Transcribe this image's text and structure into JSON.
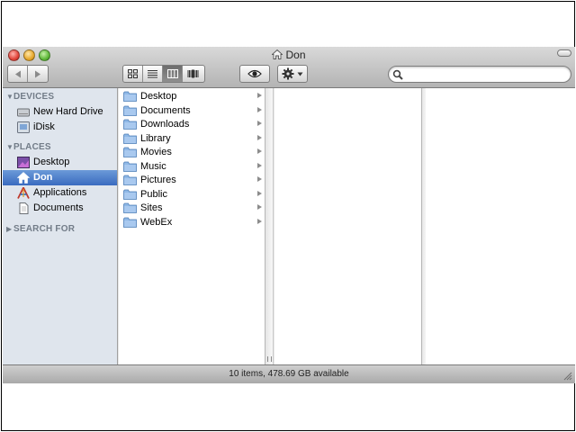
{
  "window": {
    "title": "Don"
  },
  "toolbar": {
    "back_label": "◀",
    "forward_label": "▶",
    "view_modes": [
      "icon-view",
      "list-view",
      "column-view",
      "cover-flow-view"
    ],
    "active_view": "column-view",
    "quicklook_icon": "eye-icon",
    "action_icon": "gear-icon",
    "search": {
      "value": "",
      "placeholder": ""
    }
  },
  "sidebar": {
    "sections": {
      "devices": "DEVICES",
      "places": "PLACES",
      "search_for": "SEARCH FOR"
    },
    "devices": [
      {
        "label": "New Hard Drive",
        "icon": "hard-drive-icon"
      },
      {
        "label": "iDisk",
        "icon": "idisk-icon"
      }
    ],
    "places": [
      {
        "label": "Desktop",
        "icon": "desktop-icon"
      },
      {
        "label": "Don",
        "icon": "home-icon",
        "selected": true
      },
      {
        "label": "Applications",
        "icon": "applications-icon"
      },
      {
        "label": "Documents",
        "icon": "document-icon"
      }
    ]
  },
  "column1": {
    "items": [
      {
        "label": "Desktop",
        "icon": "folder-icon"
      },
      {
        "label": "Documents",
        "icon": "folder-icon"
      },
      {
        "label": "Downloads",
        "icon": "folder-icon"
      },
      {
        "label": "Library",
        "icon": "folder-icon"
      },
      {
        "label": "Movies",
        "icon": "folder-icon"
      },
      {
        "label": "Music",
        "icon": "folder-icon"
      },
      {
        "label": "Pictures",
        "icon": "folder-icon"
      },
      {
        "label": "Public",
        "icon": "folder-icon"
      },
      {
        "label": "Sites",
        "icon": "folder-icon"
      },
      {
        "label": "WebEx",
        "icon": "folder-icon"
      }
    ]
  },
  "statusbar": {
    "text": "10 items, 478.69 GB available"
  },
  "colors": {
    "sidebar_bg": "#dfe5ed",
    "selection": "#3a6bc0",
    "section_header": "#727c88",
    "folder_blue": "#8fb8e6"
  }
}
